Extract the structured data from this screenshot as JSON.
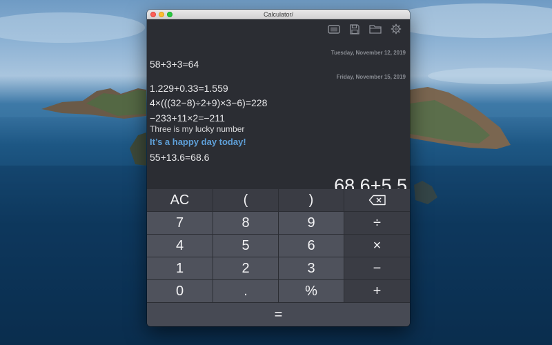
{
  "window": {
    "title": "Calculator/"
  },
  "toolbar": {
    "icons": [
      "display-icon",
      "save-icon",
      "folder-icon",
      "gear-icon"
    ]
  },
  "history": {
    "date1": "Tuesday, November 12, 2019",
    "line1": "58+3+3=64",
    "date2": "Friday, November 15, 2019",
    "line2": "1.229+0.33=1.559",
    "line3": "4×(((32−8)÷2+9)×3−6)=228",
    "line4": "−233+11×2=−211",
    "line5": "Three is my lucky number",
    "line6": "It’s a happy day today!",
    "line7": "55+13.6=68.6"
  },
  "current_expression": "68.6+5.5",
  "keys": {
    "ac": "AC",
    "paren_open": "(",
    "paren_close": ")",
    "seven": "7",
    "eight": "8",
    "nine": "9",
    "divide": "÷",
    "four": "4",
    "five": "5",
    "six": "6",
    "multiply": "×",
    "one": "1",
    "two": "2",
    "three": "3",
    "minus": "−",
    "zero": "0",
    "dot": ".",
    "percent": "%",
    "plus": "+",
    "equals": "="
  },
  "colors": {
    "window_bg": "#2b2d33",
    "number_key": "#4f525c",
    "function_key": "#3a3c44",
    "note_accent": "#5e9fd8"
  }
}
